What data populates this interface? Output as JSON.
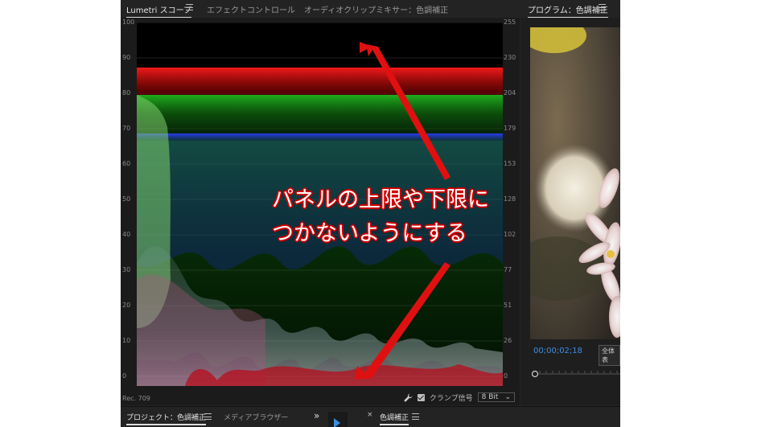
{
  "tabs_top": {
    "lumetri": "Lumetri スコープ",
    "effect": "エフェクトコントロール",
    "audio_mixer": "オーディオクリップミキサー：色調補正",
    "program": "プログラム：色調補正"
  },
  "scope": {
    "left_axis": [
      "100",
      "90",
      "80",
      "70",
      "60",
      "50",
      "40",
      "30",
      "20",
      "10",
      "0"
    ],
    "right_axis": [
      "255",
      "230",
      "204",
      "179",
      "153",
      "128",
      "102",
      "77",
      "51",
      "26",
      "0"
    ],
    "footer_left": "Rec. 709",
    "clamp_label": "クランプ信号",
    "bit_depth": "8 Bit",
    "clamp_checked": true
  },
  "program_panel": {
    "timecode": "00;00;02;18",
    "fit_label": "全体表",
    "accent_color": "#3b8fe3"
  },
  "bottom_tabs": {
    "project": "プロジェクト：色調補正",
    "media_browser": "メディアブラウザー",
    "overflow": "»",
    "timeline": "色調補正"
  },
  "annotation": {
    "line1": "パネルの上限や下限に",
    "line2": "つかないようにする",
    "arrow_color": "#e01010"
  }
}
